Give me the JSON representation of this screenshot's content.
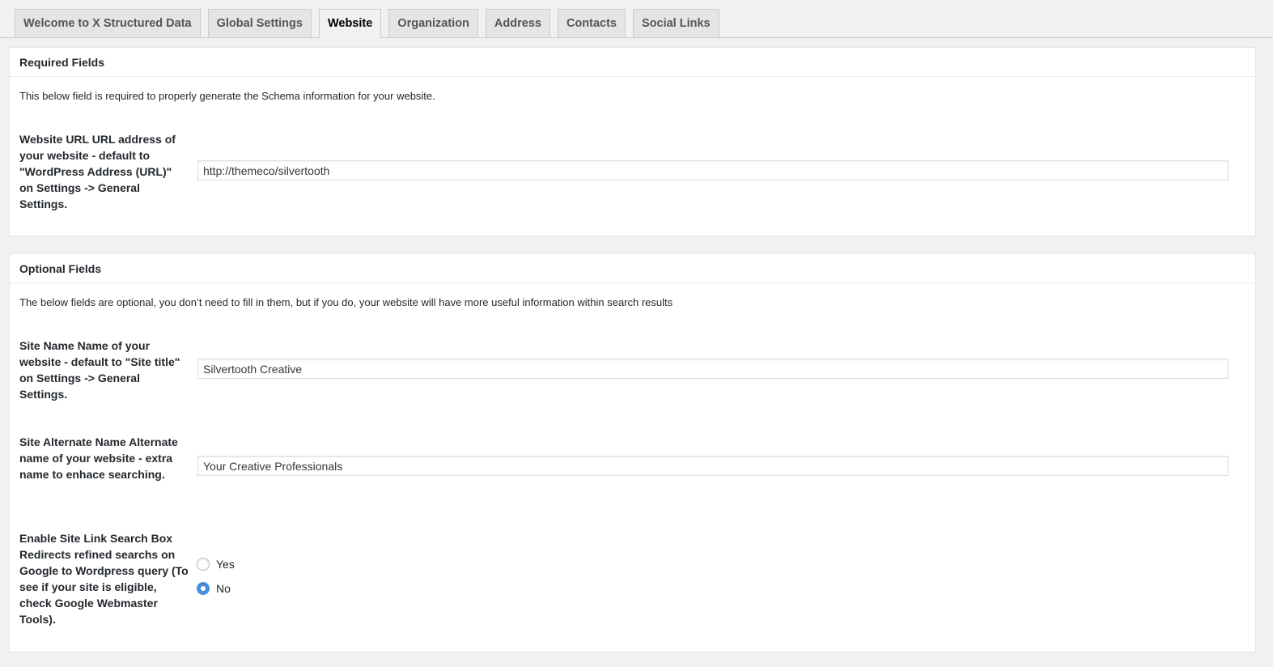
{
  "tabs": [
    {
      "label": "Welcome to X Structured Data",
      "active": false
    },
    {
      "label": "Global Settings",
      "active": false
    },
    {
      "label": "Website",
      "active": true
    },
    {
      "label": "Organization",
      "active": false
    },
    {
      "label": "Address",
      "active": false
    },
    {
      "label": "Contacts",
      "active": false
    },
    {
      "label": "Social Links",
      "active": false
    }
  ],
  "required": {
    "title": "Required Fields",
    "description": "This below field is required to properly generate the Schema information for your website.",
    "website_url": {
      "label": "Website URL URL address of your website - default to \"WordPress Address (URL)\" on Settings -> General Settings.",
      "value": "http://themeco/silvertooth"
    }
  },
  "optional": {
    "title": "Optional Fields",
    "description": "The below fields are optional, you don’t need to fill in them, but if you do, your website will have more useful information within search results",
    "site_name": {
      "label": "Site Name Name of your website - default to \"Site title\" on Settings -> General Settings.",
      "value": "Silvertooth Creative"
    },
    "site_alternate_name": {
      "label": "Site Alternate Name Alternate name of your website - extra name to enhace searching.",
      "value": "Your Creative Professionals"
    },
    "site_link_search_box": {
      "label": "Enable Site Link Search Box Redirects refined searchs on Google to Wordpress query (To see if your site is eligible, check Google Webmaster Tools).",
      "options": [
        {
          "label": "Yes",
          "checked": false
        },
        {
          "label": "No",
          "checked": true
        }
      ]
    }
  },
  "colors": {
    "accent": "#4a90e2",
    "background": "#f1f1f1",
    "panel": "#ffffff"
  }
}
